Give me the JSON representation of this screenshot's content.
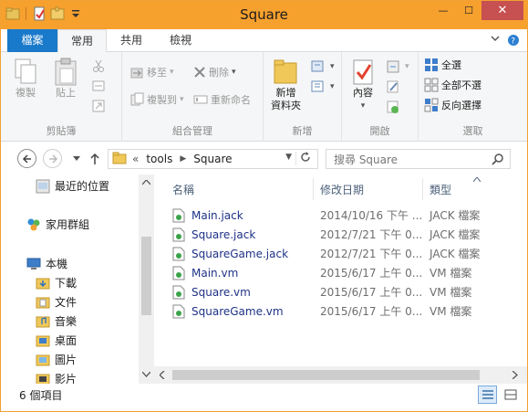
{
  "window": {
    "title": "Square"
  },
  "title_controls": {
    "minimize": "—",
    "maximize": "☐",
    "close": "✕"
  },
  "tabs": [
    {
      "label": "檔案"
    },
    {
      "label": "常用"
    },
    {
      "label": "共用"
    },
    {
      "label": "檢視"
    }
  ],
  "ribbon": {
    "clipboard": {
      "label": "剪貼簿",
      "copy": "複製",
      "paste": "貼上"
    },
    "organize": {
      "label": "組合管理",
      "move_to": "移至",
      "copy_to": "複製到",
      "delete": "刪除",
      "rename": "重新命名"
    },
    "new": {
      "label": "新增",
      "new_folder": "新增\n資料夾"
    },
    "open": {
      "label": "開啟",
      "properties": "內容"
    },
    "select": {
      "label": "選取",
      "select_all": "全選",
      "select_none": "全部不選",
      "invert": "反向選擇"
    }
  },
  "address": {
    "chevrons": "«",
    "path": [
      "tools",
      "Square"
    ]
  },
  "search": {
    "placeholder": "搜尋 Square"
  },
  "nav": {
    "items": [
      {
        "label": "最近的位置",
        "icon": "recent-places-icon"
      },
      {
        "label": "家用群組",
        "icon": "homegroup-icon"
      },
      {
        "label": "本機",
        "icon": "this-pc-icon"
      },
      {
        "label": "下載",
        "icon": "downloads-folder-icon"
      },
      {
        "label": "文件",
        "icon": "documents-folder-icon"
      },
      {
        "label": "音樂",
        "icon": "music-folder-icon"
      },
      {
        "label": "桌面",
        "icon": "desktop-folder-icon"
      },
      {
        "label": "圖片",
        "icon": "pictures-folder-icon"
      },
      {
        "label": "影片",
        "icon": "videos-folder-icon"
      }
    ]
  },
  "columns": {
    "name": "名稱",
    "date": "修改日期",
    "type": "類型"
  },
  "files": [
    {
      "name": "Main.jack",
      "date": "2014/10/16 下午 ...",
      "type": "JACK 檔案"
    },
    {
      "name": "Square.jack",
      "date": "2012/7/21 下午 0...",
      "type": "JACK 檔案"
    },
    {
      "name": "SquareGame.jack",
      "date": "2012/7/21 下午 0...",
      "type": "JACK 檔案"
    },
    {
      "name": "Main.vm",
      "date": "2015/6/17 上午 0...",
      "type": "VM 檔案"
    },
    {
      "name": "Square.vm",
      "date": "2015/6/17 上午 0...",
      "type": "VM 檔案"
    },
    {
      "name": "SquareGame.vm",
      "date": "2015/6/17 上午 0...",
      "type": "VM 檔案"
    }
  ],
  "status": {
    "count": "6 個項目"
  },
  "colors": {
    "titlebar": "#f6a02e",
    "file_tab": "#1979ca",
    "ribbon_bg": "#f5f6f7"
  }
}
